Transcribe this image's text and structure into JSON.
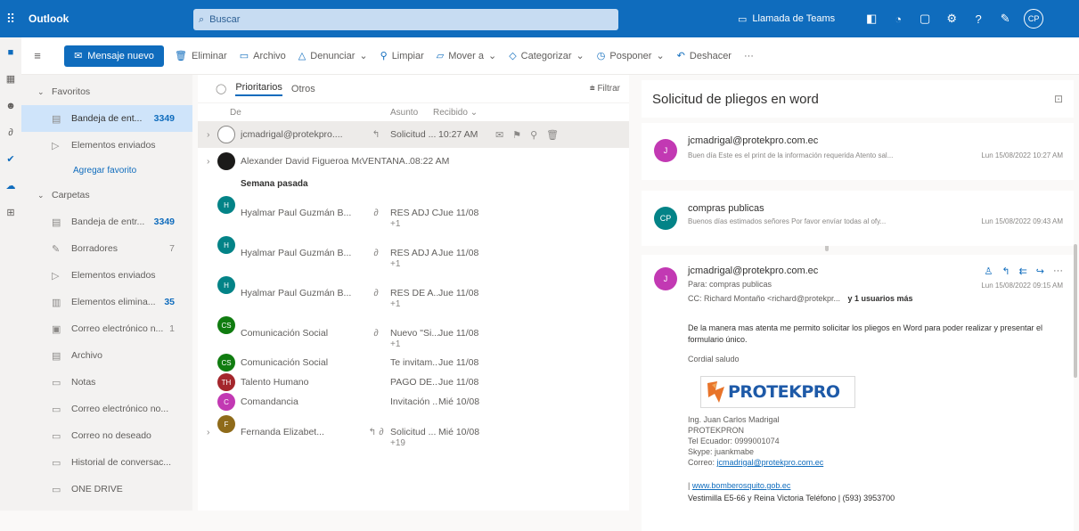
{
  "app": {
    "name": "Outlook",
    "search_placeholder": "Buscar"
  },
  "topbar": {
    "teams_label": "Llamada de Teams",
    "avatar": "CP"
  },
  "command_bar": {
    "new_message": "Mensaje nuevo",
    "actions": [
      "Eliminar",
      "Archivo",
      "Denunciar",
      "Limpiar",
      "Mover a",
      "Categorizar",
      "Posponer",
      "Deshacer",
      "···"
    ]
  },
  "folders": {
    "favorites_label": "Favoritos",
    "favorites": [
      {
        "label": "Bandeja de ent...",
        "count": "3349",
        "icon": "inbox-icon",
        "selected": true
      },
      {
        "label": "Elementos enviados",
        "count": "",
        "icon": "send-icon"
      }
    ],
    "add_favorite": "Agregar favorito",
    "folders_label": "Carpetas",
    "items": [
      {
        "label": "Bandeja de entr...",
        "count": "3349",
        "icon": "inbox-icon"
      },
      {
        "label": "Borradores",
        "count": "7",
        "plain": true,
        "icon": "draft-icon"
      },
      {
        "label": "Elementos enviados",
        "count": "",
        "icon": "send-icon"
      },
      {
        "label": "Elementos elimina...",
        "count": "35",
        "icon": "trash-icon"
      },
      {
        "label": "Correo electrónico n...",
        "count": "1",
        "plain": true,
        "icon": "junk-icon"
      },
      {
        "label": "Archivo",
        "count": "",
        "icon": "archive-icon"
      },
      {
        "label": "Notas",
        "count": "",
        "icon": "notes-icon"
      },
      {
        "label": "Correo electrónico no...",
        "count": "",
        "icon": "folder-icon"
      },
      {
        "label": "Correo no deseado",
        "count": "",
        "icon": "folder-icon"
      },
      {
        "label": "Historial de conversac...",
        "count": "",
        "icon": "folder-icon"
      },
      {
        "label": "ONE DRIVE",
        "count": "",
        "icon": "folder-icon"
      }
    ]
  },
  "message_list": {
    "tabs": [
      "Prioritarios",
      "Otros"
    ],
    "filter": "Filtrar",
    "columns": {
      "from": "De",
      "subject": "Asunto",
      "received": "Recibido"
    },
    "group_last_week": "Semana pasada",
    "rows_top": [
      {
        "from": "jcmadrigal@protekpro....",
        "subject": "Solicitud ...",
        "date": "10:27 AM",
        "avatar": "",
        "color": "#ffffff",
        "selected": true
      },
      {
        "from": "Alexander David Figueroa Mo...",
        "subject": "VENTANA...",
        "date": "08:22 AM",
        "avatar": "",
        "color": "#1b1a19"
      }
    ],
    "rows_week": [
      {
        "from": "Hyalmar Paul Guzmán B...",
        "subject": "RES ADJ C...",
        "date": "Jue 11/08",
        "avatar": "H",
        "color": "#038387",
        "more": "+1"
      },
      {
        "from": "Hyalmar Paul Guzmán B...",
        "subject": "RES ADJ A...",
        "date": "Jue 11/08",
        "avatar": "H",
        "color": "#038387",
        "more": "+1"
      },
      {
        "from": "Hyalmar Paul Guzmán B...",
        "subject": "RES DE A...",
        "date": "Jue 11/08",
        "avatar": "H",
        "color": "#038387",
        "more": "+1"
      },
      {
        "from": "Comunicación Social",
        "subject": "Nuevo \"Si...",
        "date": "Jue 11/08",
        "avatar": "CS",
        "color": "#107c10",
        "more": "+1"
      },
      {
        "from": "Comunicación Social",
        "subject": "Te invitam...",
        "date": "Jue 11/08",
        "avatar": "CS",
        "color": "#107c10"
      },
      {
        "from": "Talento Humano",
        "subject": "PAGO DE...",
        "date": "Jue 11/08",
        "avatar": "TH",
        "color": "#a4262c"
      },
      {
        "from": "Comandancia",
        "subject": "Invitación ...",
        "date": "Mié 10/08",
        "avatar": "C",
        "color": "#c239b3"
      },
      {
        "from": "Fernanda Elizabet...",
        "subject": "Solicitud ...",
        "date": "Mié 10/08",
        "avatar": "F",
        "color": "#8f6b1a",
        "more": "+19"
      }
    ]
  },
  "reading": {
    "title": "Solicitud de pliegos en word",
    "cards": [
      {
        "sender": "jcmadrigal@protekpro.com.ec",
        "preview": "Buen día Este es el print de la información requerida Atento sal...",
        "date": "Lun 15/08/2022 10:27 AM",
        "avatar": "J",
        "color": "#c239b3"
      },
      {
        "sender": "compras publicas",
        "preview": "Buenos días estimados señores Por favor envíar todas al ofy...",
        "date": "Lun 15/08/2022 09:43 AM",
        "avatar": "CP",
        "color": "#038387"
      }
    ],
    "expanded": {
      "sender": "jcmadrigal@protekpro.com.ec",
      "to": "Para: compras publicas",
      "cc": "CC: Richard Montaño <richard@protekpr...",
      "cc_more": "y 1 usuarios más",
      "date": "Lun 15/08/2022 09:15 AM",
      "avatar": "J",
      "color": "#c239b3",
      "body": "De la manera mas atenta me permito solicitar los pliegos en Word para poder realizar y presentar el formulario único.",
      "greeting": "Cordial saludo",
      "logo_text": "PROTEKPRO",
      "sig": [
        "Ing. Juan Carlos Madrigal",
        "PROTEKPRON",
        "Tel Ecuador: 0999001074",
        "Skype: juankmabe"
      ],
      "sig_mail_label": "Correo:",
      "sig_mail": "jcmadrigal@protekpro.com.ec",
      "site": "www.bomberosquito.gob.ec",
      "address": "Vestimilla E5-66 y Reina Victoria Teléfono | (593) 3953700"
    }
  }
}
